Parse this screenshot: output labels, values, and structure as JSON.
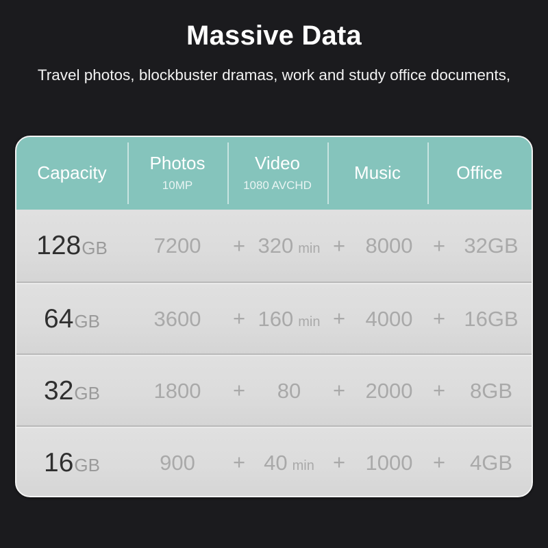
{
  "hero": {
    "title": "Massive Data",
    "subtitle": "Travel photos, blockbuster dramas, work and study office documents,"
  },
  "colors": {
    "background": "#1b1b1e",
    "header_teal": "#85c4bc",
    "card_body": "#dcdcdc",
    "capacity_text": "#2f2f2f",
    "value_text": "#a9a9a9",
    "header_text": "#ffffff"
  },
  "table": {
    "columns": [
      {
        "label": "Capacity",
        "sublabel": ""
      },
      {
        "label": "Photos",
        "sublabel": "10MP"
      },
      {
        "label": "Video",
        "sublabel": "1080 AVCHD"
      },
      {
        "label": "Music",
        "sublabel": ""
      },
      {
        "label": "Office",
        "sublabel": ""
      }
    ],
    "separator": "+",
    "rows": [
      {
        "capacity_value": "128",
        "capacity_unit": "GB",
        "photos": "7200",
        "photos_unit": "",
        "video": "320",
        "video_unit": "min",
        "music": "8000",
        "music_unit": "",
        "office": "32GB",
        "office_unit": ""
      },
      {
        "capacity_value": "64",
        "capacity_unit": "GB",
        "photos": "3600",
        "photos_unit": "",
        "video": "160",
        "video_unit": "min",
        "music": "4000",
        "music_unit": "",
        "office": "16GB",
        "office_unit": ""
      },
      {
        "capacity_value": "32",
        "capacity_unit": "GB",
        "photos": "1800",
        "photos_unit": "",
        "video": "80",
        "video_unit": "",
        "music": "2000",
        "music_unit": "",
        "office": "8GB",
        "office_unit": ""
      },
      {
        "capacity_value": "16",
        "capacity_unit": "GB",
        "photos": "900",
        "photos_unit": "",
        "video": "40",
        "video_unit": "min",
        "music": "1000",
        "music_unit": "",
        "office": "4GB",
        "office_unit": ""
      }
    ]
  }
}
